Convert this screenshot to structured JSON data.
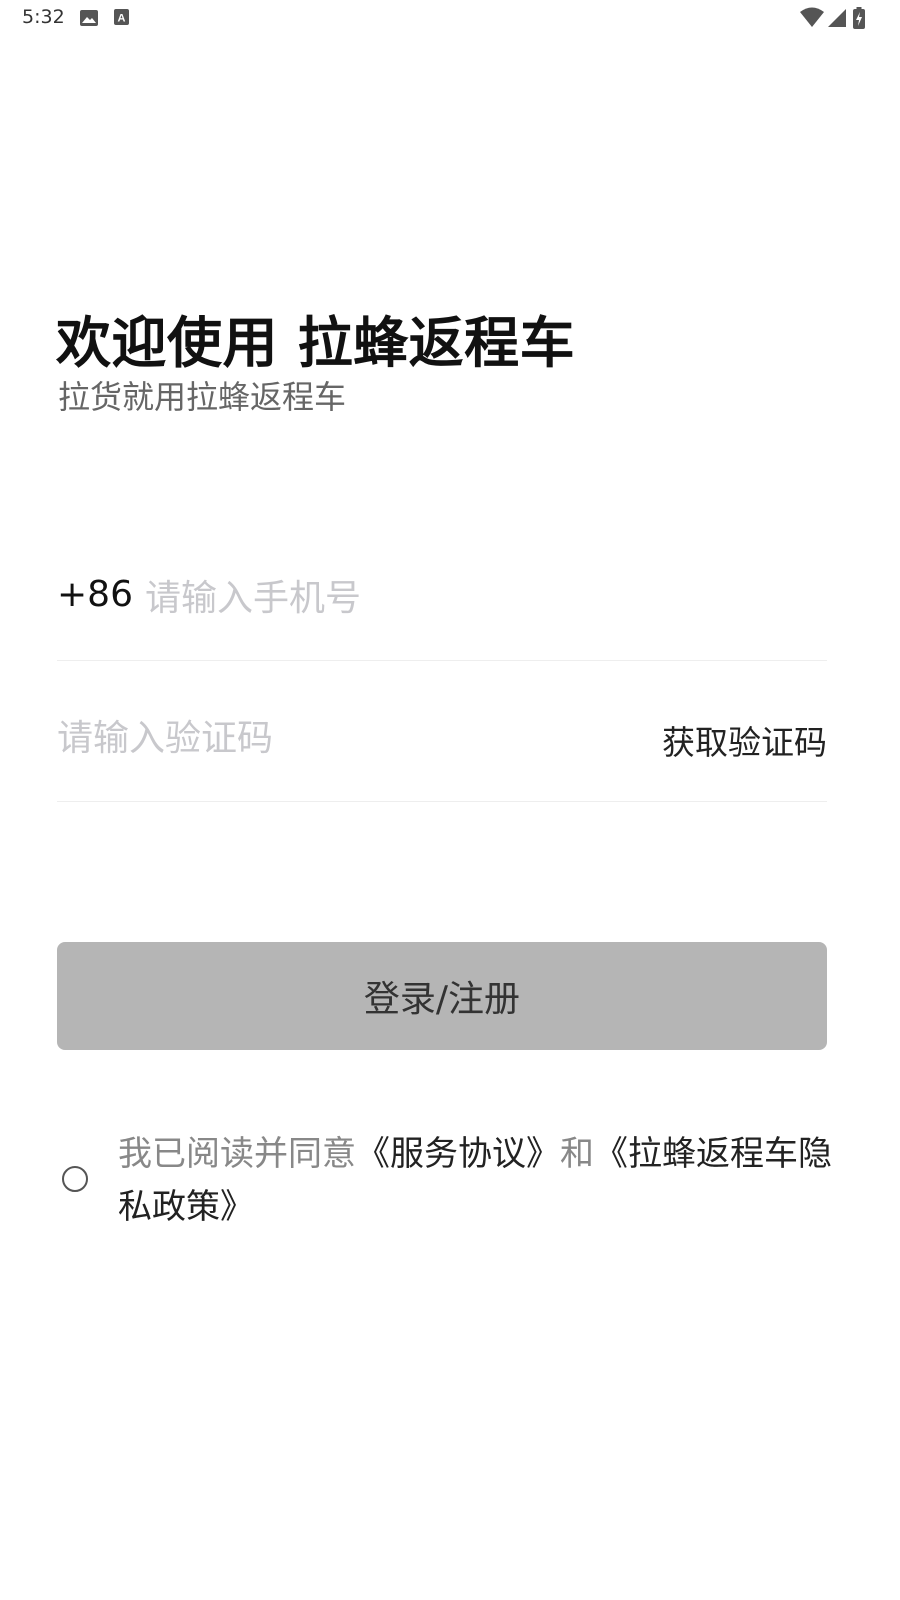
{
  "status_bar": {
    "time": "5:32",
    "left_icons": [
      "image-icon",
      "a-letter-icon"
    ],
    "right_icons": [
      "wifi-icon",
      "cellular-signal-icon",
      "battery-charging-icon"
    ]
  },
  "title": "欢迎使用 拉蜂返程车",
  "subtitle": "拉货就用拉蜂返程车",
  "phone": {
    "country_code": "+86",
    "placeholder": "请输入手机号",
    "value": ""
  },
  "code": {
    "placeholder": "请输入验证码",
    "value": "",
    "get_code_label": "获取验证码"
  },
  "login_button": {
    "label": "登录/注册",
    "background": "#b5b5b5"
  },
  "agreement": {
    "checked": false,
    "prefix": "我已阅读并同意",
    "service_link": "《服务协议》",
    "and": "和",
    "privacy_link": "《拉蜂返程车隐私政策》"
  }
}
